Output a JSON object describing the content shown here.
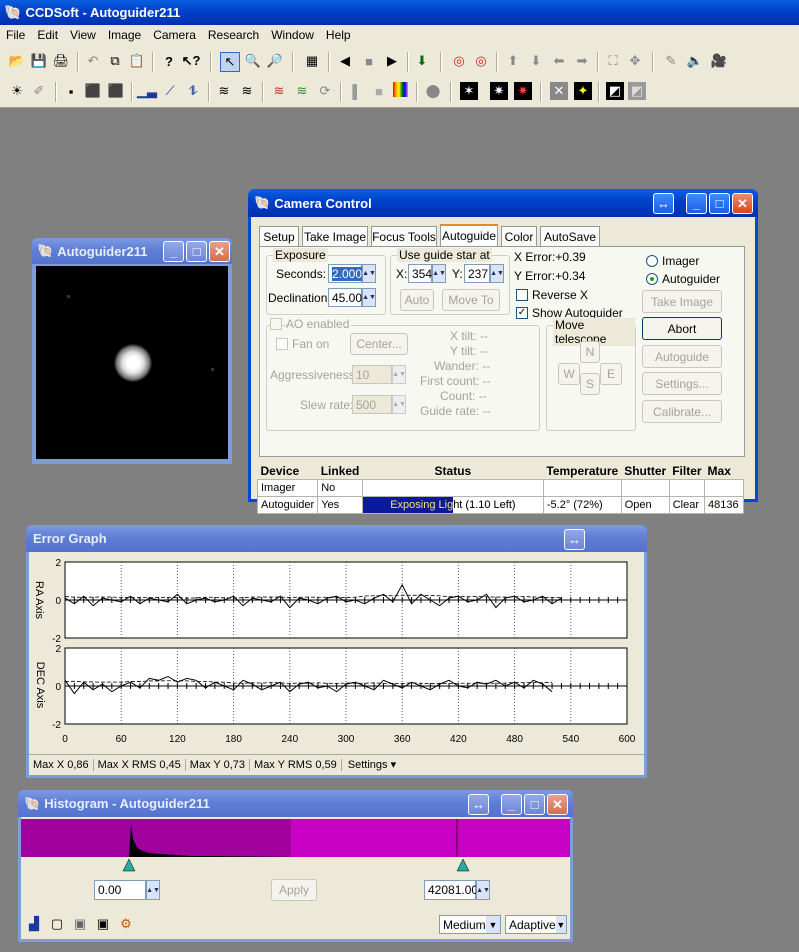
{
  "app": {
    "title": "CCDSoft - Autoguider211"
  },
  "menu": [
    "File",
    "Edit",
    "View",
    "Image",
    "Camera",
    "Research",
    "Window",
    "Help"
  ],
  "imageWindow": {
    "title": "Autoguider211"
  },
  "cameraControl": {
    "title": "Camera Control",
    "tabs": [
      "Setup",
      "Take Image",
      "Focus Tools",
      "Autoguide",
      "Color",
      "AutoSave"
    ],
    "exposure": {
      "legend": "Exposure",
      "seconds_label": "Seconds:",
      "seconds_value": "2.000",
      "declination_label": "Declination:",
      "declination_value": "45.00"
    },
    "guideStar": {
      "legend": "Use guide star at",
      "x_label": "X:",
      "x_value": "354",
      "y_label": "Y:",
      "y_value": "237",
      "auto_label": "Auto",
      "moveto_label": "Move To"
    },
    "xerror": "X Error:+0.39",
    "yerror": "Y Error:+0.34",
    "reverse_x": "Reverse X",
    "show_autoguider": "Show Autoguider",
    "imager_radio": "Imager",
    "autoguider_radio": "Autoguider",
    "buttons": {
      "take_image": "Take Image",
      "abort": "Abort",
      "autoguide": "Autoguide",
      "settings": "Settings...",
      "calibrate": "Calibrate..."
    },
    "ao": {
      "enabled": "AO enabled",
      "fan_on": "Fan on",
      "center": "Center...",
      "aggressiveness_label": "Aggressiveness:",
      "aggressiveness_value": "10",
      "slew_label": "Slew rate:",
      "slew_value": "500",
      "x_tilt": "X tilt: --",
      "y_tilt": "Y tilt: --",
      "wander": "Wander: --",
      "first_count": "First count: --",
      "count": "Count: --",
      "guide_rate": "Guide rate: --"
    },
    "move": {
      "legend": "Move telescope",
      "n": "N",
      "s": "S",
      "w": "W",
      "e": "E"
    },
    "table": {
      "headers": [
        "Device",
        "Linked",
        "Status",
        "Temperature",
        "Shutter",
        "Filter",
        "Max"
      ],
      "rows": [
        [
          "Imager",
          "No",
          "",
          "",
          "",
          "",
          ""
        ],
        [
          "Autoguider",
          "Yes",
          "Exposing Light (1.10 Left)",
          "-5.2° (72%)",
          "Open",
          "Clear",
          "48136"
        ]
      ],
      "progress": 0.5
    }
  },
  "errorGraph": {
    "title": "Error Graph",
    "ra_label": "RA Axis",
    "dec_label": "DEC Axis",
    "y_ticks": [
      "2",
      "0",
      "-2"
    ],
    "status": {
      "maxx": "Max X 0,86",
      "maxxrms": "Max X RMS 0,45",
      "maxy": "Max Y 0,73",
      "maxyrms": "Max Y RMS 0,59",
      "settings": "Settings"
    }
  },
  "chart_data": {
    "type": "line",
    "x_ticks": [
      0,
      60,
      120,
      180,
      240,
      300,
      360,
      420,
      480,
      540,
      600
    ],
    "xlim": [
      0,
      600
    ],
    "ylim": [
      -2,
      2
    ],
    "series": [
      {
        "axis": "RA",
        "values": [
          0.1,
          -0.2,
          0.2,
          -0.3,
          0.1,
          0.0,
          -0.1,
          0.2,
          -0.2,
          0.1,
          0.0,
          -0.1,
          0.3,
          -0.2,
          0.0,
          0.1,
          -0.1,
          0.0,
          0.2,
          -0.3,
          0.1,
          0.0,
          -0.1,
          0.2,
          -0.4,
          0.1,
          0.0,
          -0.2,
          0.1,
          0.2,
          -0.1,
          0.0,
          -0.2,
          0.1,
          0.3,
          -0.1,
          0.8,
          -0.2,
          0.3,
          0.0,
          -0.3,
          0.1,
          0.2,
          -0.1,
          0.0,
          0.3,
          -0.4,
          0.1,
          0.2,
          -0.1,
          0.0,
          0.2,
          -0.2,
          0.1
        ]
      },
      {
        "axis": "DEC",
        "values": [
          0.3,
          -0.4,
          0.2,
          -0.2,
          0.1,
          -0.3,
          0.0,
          0.2,
          -0.1,
          0.4,
          0.3,
          0.5,
          0.2,
          0.4,
          0.3,
          -0.1,
          0.2,
          0.0,
          -0.2,
          0.3,
          0.1,
          -0.2,
          0.0,
          0.2,
          -0.3,
          0.1,
          0.2,
          -0.1,
          0.0,
          -0.3,
          0.1,
          0.2,
          0.0,
          -0.2,
          0.3,
          0.1,
          -0.1,
          0.2,
          0.0,
          -0.2,
          0.1,
          0.3,
          0.0,
          -0.1,
          0.2,
          0.1,
          0.3,
          0.0,
          0.2,
          -0.1,
          0.3,
          0.1,
          -0.3
        ]
      }
    ]
  },
  "histogram": {
    "title": "Histogram - Autoguider211",
    "low": "0.00",
    "high": "42081.00",
    "apply": "Apply",
    "medium": "Medium",
    "adaptive": "Adaptive"
  }
}
